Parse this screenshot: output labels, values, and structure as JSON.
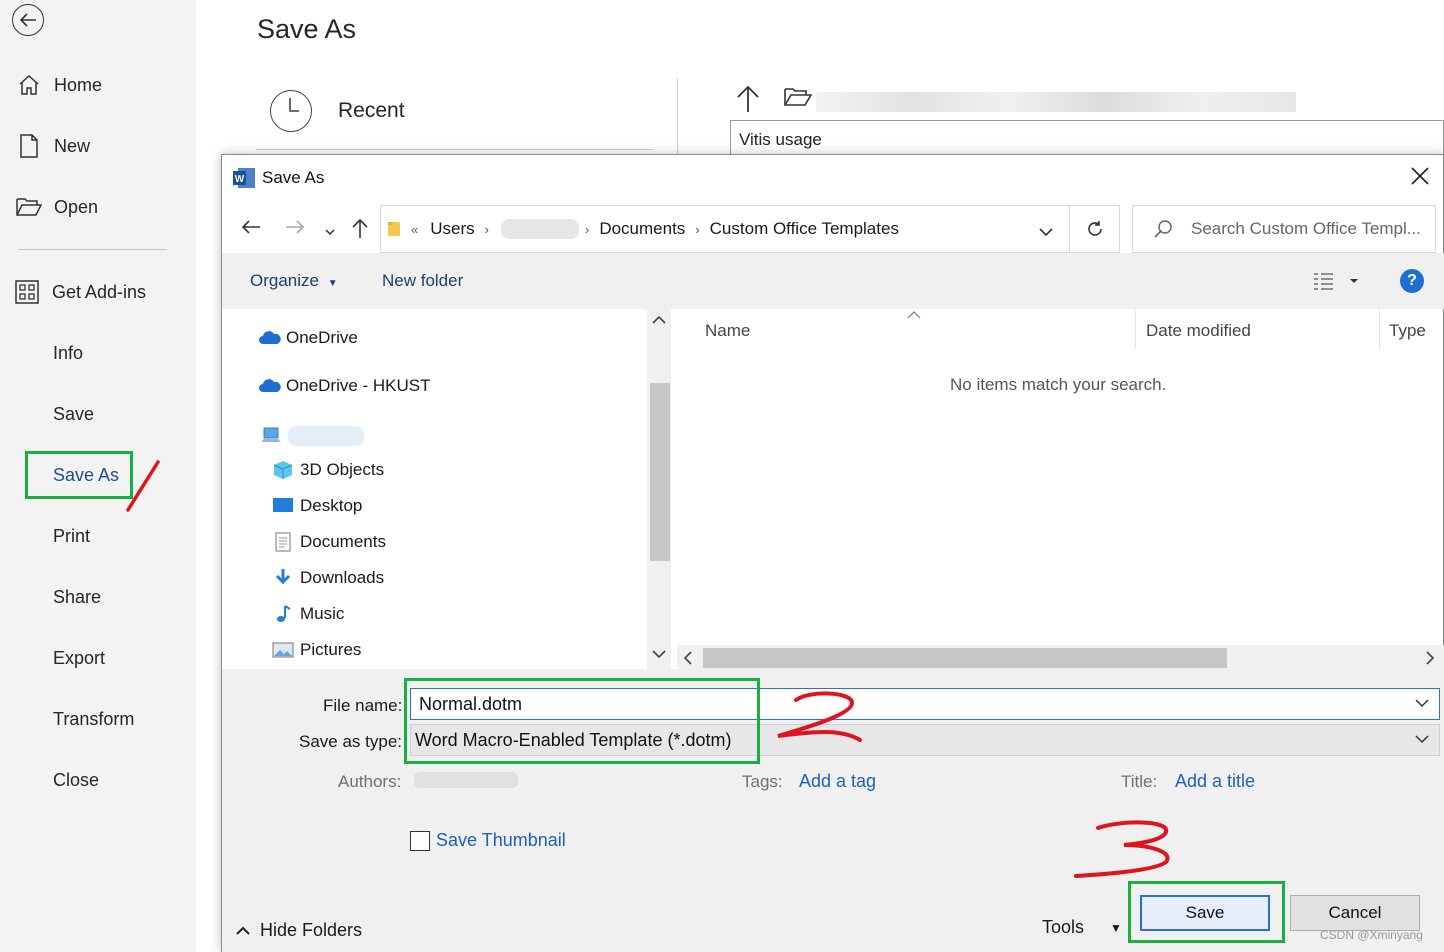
{
  "backstage": {
    "title": "Save As",
    "nav": [
      {
        "label": "Home"
      },
      {
        "label": "New"
      },
      {
        "label": "Open"
      },
      {
        "label": "Get Add-ins"
      },
      {
        "label": "Info"
      },
      {
        "label": "Save"
      },
      {
        "label": "Save As"
      },
      {
        "label": "Print"
      },
      {
        "label": "Share"
      },
      {
        "label": "Export"
      },
      {
        "label": "Transform"
      },
      {
        "label": "Close"
      }
    ],
    "recent_label": "Recent",
    "path_value": "Vitis usage"
  },
  "dialog": {
    "title": "Save As",
    "address": {
      "overflow": "«",
      "segments": [
        "Users",
        "Documents",
        "Custom Office Templates"
      ]
    },
    "search_placeholder": "Search Custom Office Templ...",
    "toolbar": {
      "organize": "Organize",
      "new_folder": "New folder",
      "help": "?"
    },
    "tree": [
      {
        "label": "OneDrive",
        "icon": "cloud-icon"
      },
      {
        "label": "OneDrive - HKUST",
        "icon": "cloud-icon"
      },
      {
        "label": "3D Objects",
        "icon": "cube-icon"
      },
      {
        "label": "Desktop",
        "icon": "desktop-icon"
      },
      {
        "label": "Documents",
        "icon": "document-icon"
      },
      {
        "label": "Downloads",
        "icon": "download-icon"
      },
      {
        "label": "Music",
        "icon": "music-icon"
      },
      {
        "label": "Pictures",
        "icon": "picture-icon"
      }
    ],
    "columns": {
      "name": "Name",
      "date": "Date modified",
      "type": "Type"
    },
    "empty_message": "No items match your search.",
    "file_name_label": "File name:",
    "file_name": "Normal.dotm",
    "save_type_label": "Save as type:",
    "save_type": "Word Macro-Enabled Template (*.dotm)",
    "authors_label": "Authors:",
    "tags_label": "Tags:",
    "add_tag": "Add a tag",
    "title_label": "Title:",
    "add_title": "Add a title",
    "save_thumbnail": "Save Thumbnail",
    "hide_folders": "Hide Folders",
    "tools": "Tools",
    "save_button": "Save",
    "cancel_button": "Cancel"
  },
  "annotations": {
    "step2": "2",
    "step3": "3"
  },
  "watermark": "CSDN @Xminyang",
  "colors": {
    "highlight": "#18b040",
    "annotation": "#e0141e",
    "accent": "#2a6fd6"
  }
}
